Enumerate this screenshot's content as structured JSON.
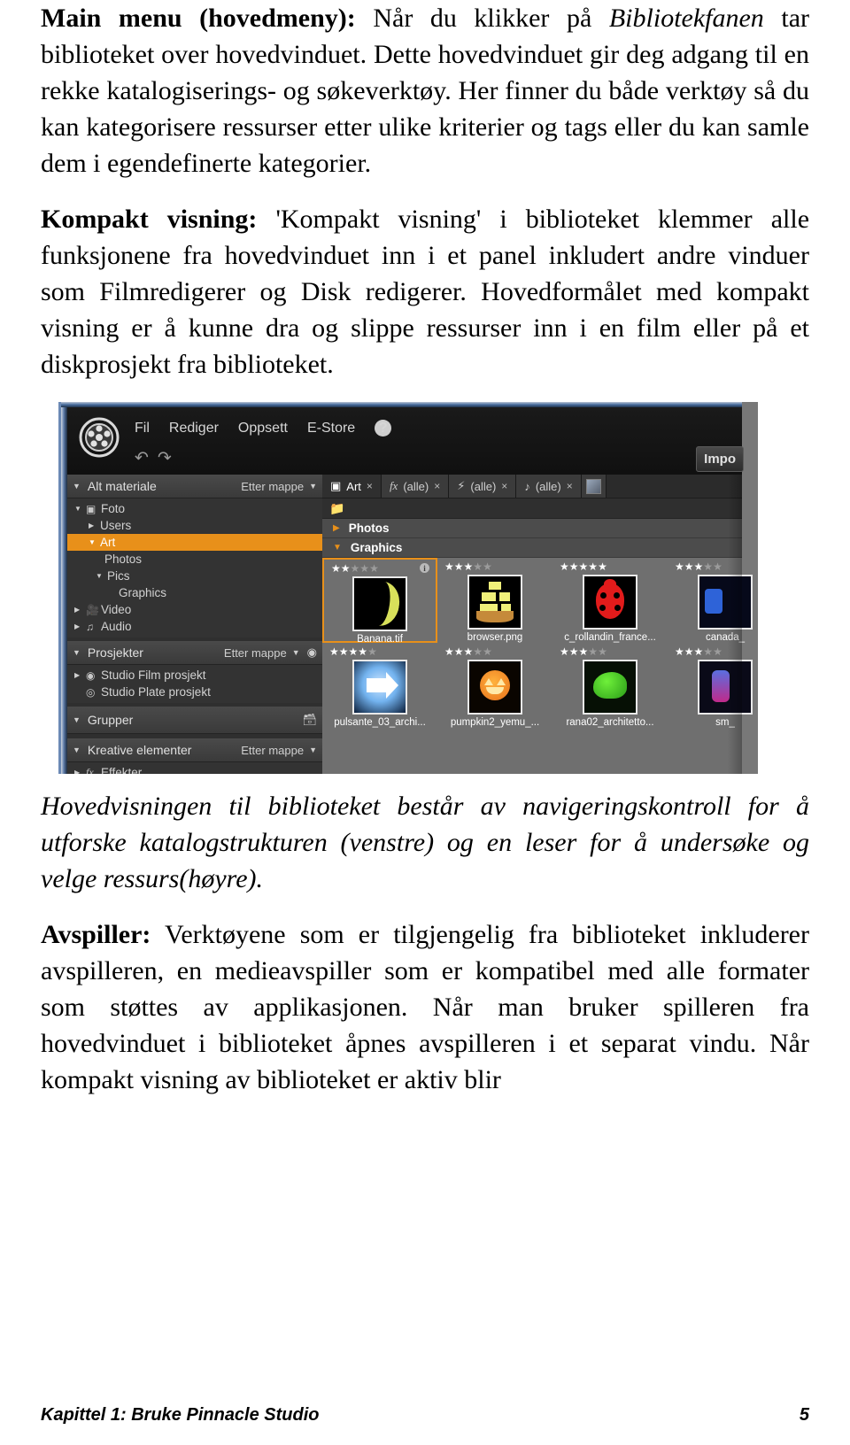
{
  "paragraphs": {
    "p1": {
      "lead": "Main menu (hovedmeny):",
      "rest": " Når du klikker på Bibliotekfanen tar biblioteket over hovedvinduet. Dette hovedvinduet gir deg adgang til en rekke katalogiserings- og søkeverktøy. Her finner du både verktøy så du kan kategorisere ressurser etter ulike kriterier og tags eller du kan samle dem i egendefinerte kategorier.",
      "italic_part": "Bibliotekfanen"
    },
    "p2": {
      "lead": "Kompakt visning:",
      "rest": " 'Kompakt visning' i biblioteket klemmer alle funksjonene fra hovedvinduet inn i et panel inkludert andre vinduer som Filmredigerer og Disk redigerer. Hovedformålet med kompakt visning er å kunne dra og slippe ressurser inn i en film eller på et diskprosjekt fra biblioteket."
    },
    "caption": "Hovedvisningen til biblioteket består av navigeringskontroll for å utforske katalogstrukturen (venstre) og en leser for å undersøke og velge ressurs(høyre).",
    "p3": {
      "lead": "Avspiller:",
      "rest": " Verktøyene som er tilgjengelig fra biblioteket inkluderer avspilleren, en medieavspiller som er kompatibel med alle formater som støttes av applikasjonen. Når man bruker spilleren fra hovedvinduet i biblioteket åpnes avspilleren i et separat vindu. Når kompakt visning av biblioteket er aktiv blir"
    }
  },
  "footer": {
    "chapter": "Kapittel 1: Bruke Pinnacle Studio",
    "page_number": "5"
  },
  "screenshot": {
    "menubar": {
      "logo_icon": "film-reel-icon",
      "items": [
        "Fil",
        "Rediger",
        "Oppsett",
        "E-Store"
      ],
      "help_label": "?",
      "undo_icon": "undo-arrow-icon",
      "redo_icon": "redo-arrow-icon",
      "import_button": "Impo"
    },
    "sidebar": {
      "sections": [
        {
          "title": "Alt materiale",
          "sort_label": "Etter mappe",
          "items": [
            {
              "label": "Foto",
              "icon": "camera-icon",
              "arrow": "down",
              "indent": 1
            },
            {
              "label": "Users",
              "icon": "",
              "arrow": "right",
              "indent": 2
            },
            {
              "label": "Art",
              "icon": "",
              "arrow": "down",
              "indent": 2,
              "selected": true
            },
            {
              "label": "Photos",
              "icon": "",
              "arrow": "",
              "indent": 3
            },
            {
              "label": "Pics",
              "icon": "",
              "arrow": "down",
              "indent": 3
            },
            {
              "label": "Graphics",
              "icon": "",
              "arrow": "",
              "indent": 4
            },
            {
              "label": "Video",
              "icon": "video-camera-icon",
              "arrow": "right",
              "indent": 1
            },
            {
              "label": "Audio",
              "icon": "music-note-icon",
              "arrow": "right",
              "indent": 1
            }
          ]
        },
        {
          "title": "Prosjekter",
          "sort_label": "Etter mappe",
          "add_icon": "add-project-icon",
          "items": [
            {
              "label": "Studio Film prosjekt",
              "icon": "film-reel-icon",
              "arrow": "right",
              "indent": 1
            },
            {
              "label": "Studio Plate prosjekt",
              "icon": "disc-icon",
              "arrow": "",
              "indent": 1
            }
          ]
        },
        {
          "title": "Grupper",
          "sort_label": "",
          "add_icon": "add-group-icon",
          "items": []
        },
        {
          "title": "Kreative elementer",
          "sort_label": "Etter mappe",
          "items": [
            {
              "label": "Effekter",
              "icon": "fx-icon",
              "arrow": "right",
              "indent": 1
            }
          ]
        }
      ]
    },
    "content": {
      "filter_chips": [
        {
          "icon": "camera-icon",
          "label": "Art",
          "active": true,
          "close": "×"
        },
        {
          "icon": "fx-icon",
          "label": "(alle)",
          "active": false,
          "close": "×"
        },
        {
          "icon": "lightning-icon",
          "label": "(alle)",
          "active": false,
          "close": "×"
        },
        {
          "icon": "music-note-icon",
          "label": "(alle)",
          "active": false,
          "close": "×"
        }
      ],
      "toolrow_icon": "new-folder-icon",
      "groups": [
        {
          "label": "Photos",
          "expanded": false
        },
        {
          "label": "Graphics",
          "expanded": true
        }
      ],
      "thumbnails": [
        [
          {
            "name": "Banana.tif",
            "rating": 2,
            "selected": true,
            "info": "i",
            "art": "banana"
          },
          {
            "name": "browser.png",
            "rating": 3,
            "selected": false,
            "info": "",
            "art": "ship"
          },
          {
            "name": "c_rollandin_france...",
            "rating": 5,
            "selected": false,
            "info": "",
            "art": "ladybug"
          },
          {
            "name": "canada_",
            "rating": 3,
            "selected": false,
            "info": "",
            "art": "canada"
          }
        ],
        [
          {
            "name": "pulsante_03_archi...",
            "rating": 4,
            "selected": false,
            "info": "",
            "art": "arrow"
          },
          {
            "name": "pumpkin2_yemu_...",
            "rating": 3,
            "selected": false,
            "info": "",
            "art": "pumpkin"
          },
          {
            "name": "rana02_architetto...",
            "rating": 3,
            "selected": false,
            "info": "",
            "art": "frog"
          },
          {
            "name": "sm_",
            "rating": 3,
            "selected": false,
            "info": "",
            "art": "sm"
          }
        ]
      ]
    }
  },
  "colors": {
    "accent_orange": "#e8901a",
    "panel_dark": "#2f2f2f",
    "content_gray": "#6f6f6f"
  }
}
